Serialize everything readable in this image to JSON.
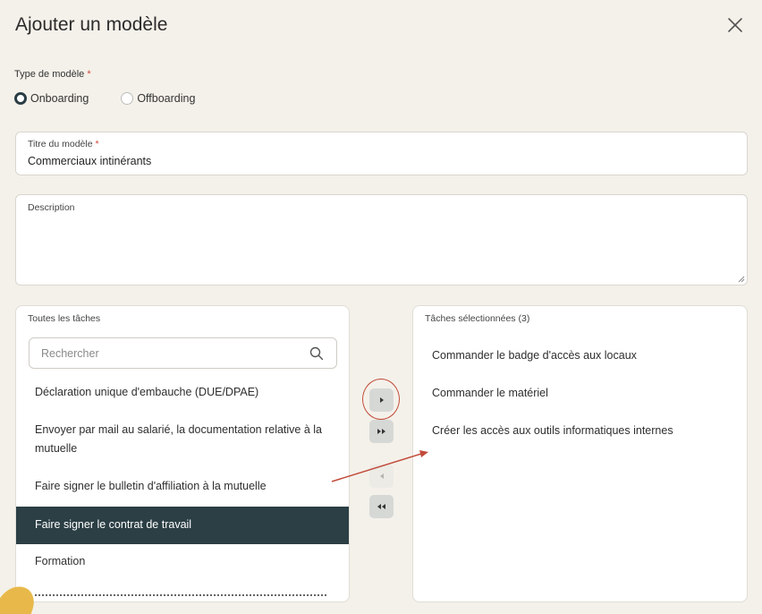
{
  "dialog": {
    "title": "Ajouter un modèle"
  },
  "type": {
    "label": "Type de modèle",
    "required_mark": "*",
    "options": [
      {
        "label": "Onboarding",
        "checked": true
      },
      {
        "label": "Offboarding",
        "checked": false
      }
    ]
  },
  "title_field": {
    "label": "Titre du modèle",
    "required_mark": "*",
    "value": "Commerciaux intinérants"
  },
  "description_field": {
    "label": "Description",
    "value": ""
  },
  "all_tasks": {
    "title": "Toutes les tâches",
    "search_placeholder": "Rechercher",
    "items": [
      {
        "label": "Déclaration unique d'embauche (DUE/DPAE)"
      },
      {
        "label": "Envoyer par mail au salarié, la documentation relative à la mutuelle"
      },
      {
        "label": "Faire signer le bulletin d'affiliation à la mutuelle"
      },
      {
        "label": "Faire signer le contrat de travail",
        "selected": true
      },
      {
        "label": "Formation"
      }
    ]
  },
  "selected_tasks": {
    "title": "Tâches sélectionnées (3)",
    "items": [
      {
        "label": "Commander le badge d'accès aux locaux"
      },
      {
        "label": "Commander le matériel"
      },
      {
        "label": "Créer les accès aux outils informatiques internes"
      }
    ]
  },
  "colors": {
    "background": "#f4f1ea",
    "selected_row": "#2b3f45",
    "annotation": "#c24b3a",
    "required": "#d0453a"
  },
  "icons": [
    "close-icon",
    "search-icon",
    "chevron-right-icon",
    "double-chevron-right-icon",
    "chevron-left-icon",
    "double-chevron-left-icon"
  ]
}
